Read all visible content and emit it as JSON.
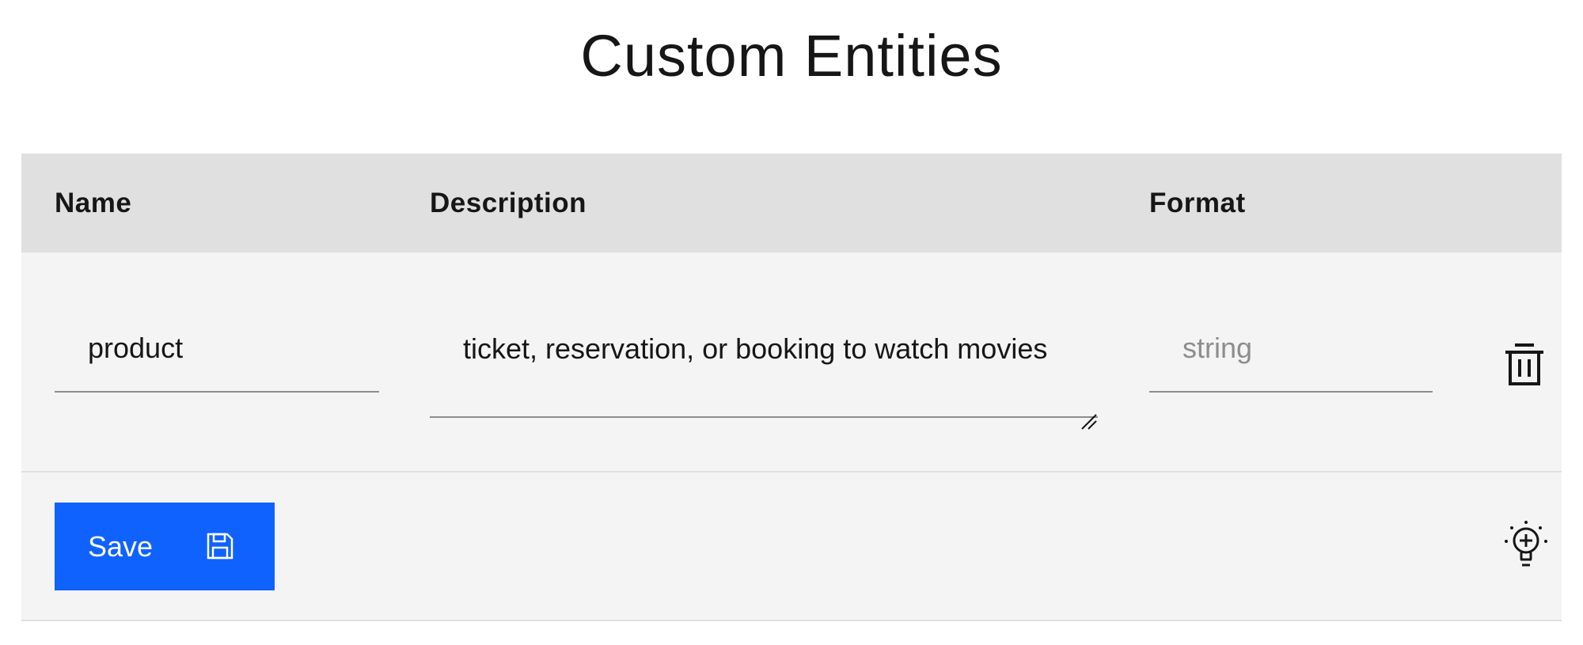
{
  "page": {
    "title": "Custom Entities"
  },
  "table": {
    "headers": {
      "name": "Name",
      "description": "Description",
      "format": "Format"
    },
    "rows": [
      {
        "name": "product",
        "description": "ticket, reservation, or booking to watch movies",
        "format_placeholder": "string",
        "delete_icon": "trash-icon"
      }
    ]
  },
  "footer": {
    "save_label": "Save",
    "save_icon": "save-icon",
    "suggest_icon": "lightbulb-add-icon"
  },
  "colors": {
    "primary_button": "#0f62fe",
    "header_bg": "#e0e0e0",
    "row_bg": "#f4f4f4"
  }
}
